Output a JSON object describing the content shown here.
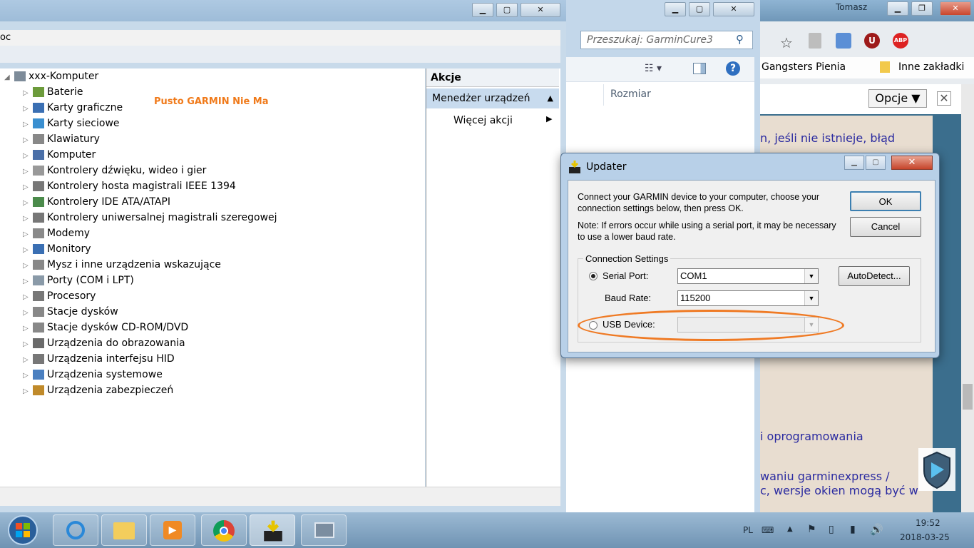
{
  "browser": {
    "user": "Tomasz",
    "bookmarks": [
      "Gangsters Pienia",
      "Inne zakładki"
    ],
    "options_button": "Opcje ▼",
    "page_lines": [
      "n, jeśli nie istnieje, błąd",
      "i oprogramowania",
      "waniu garminexpress /",
      "c, wersje okien mogą być w"
    ]
  },
  "explorer": {
    "search_placeholder": "Przeszukaj: GarminCure3",
    "column_size": "Rozmiar"
  },
  "device_manager": {
    "menu_fragment": "oc",
    "root": "xxx-Komputer",
    "annotation": "Pusto GARMIN Nie Ma",
    "categories": [
      "Baterie",
      "Karty graficzne",
      "Karty sieciowe",
      "Klawiatury",
      "Komputer",
      "Kontrolery dźwięku, wideo i gier",
      "Kontrolery hosta magistrali IEEE 1394",
      "Kontrolery IDE ATA/ATAPI",
      "Kontrolery uniwersalnej magistrali szeregowej",
      "Modemy",
      "Monitory",
      "Mysz i inne urządzenia wskazujące",
      "Porty (COM i LPT)",
      "Procesory",
      "Stacje dysków",
      "Stacje dysków CD-ROM/DVD",
      "Urządzenia do obrazowania",
      "Urządzenia interfejsu HID",
      "Urządzenia systemowe",
      "Urządzenia zabezpieczeń"
    ],
    "actions_header": "Akcje",
    "actions_selected": "Menedżer urządzeń",
    "actions_more": "Więcej akcji"
  },
  "updater": {
    "title": "Updater",
    "message1": "Connect your GARMIN device to your computer, choose your connection settings below, then press OK.",
    "message2": "Note: If errors occur while using a serial port, it may be necessary to use a lower baud rate.",
    "ok": "OK",
    "cancel": "Cancel",
    "group_label": "Connection Settings",
    "serial_label": "Serial Port:",
    "serial_value": "COM1",
    "baud_label": "Baud Rate:",
    "baud_value": "115200",
    "usb_label": "USB Device:",
    "usb_value": "",
    "autodetect": "AutoDetect...",
    "highlight_color": "#ef7a24"
  },
  "taskbar": {
    "lang": "PL",
    "time": "19:52",
    "date": "2018-03-25"
  }
}
